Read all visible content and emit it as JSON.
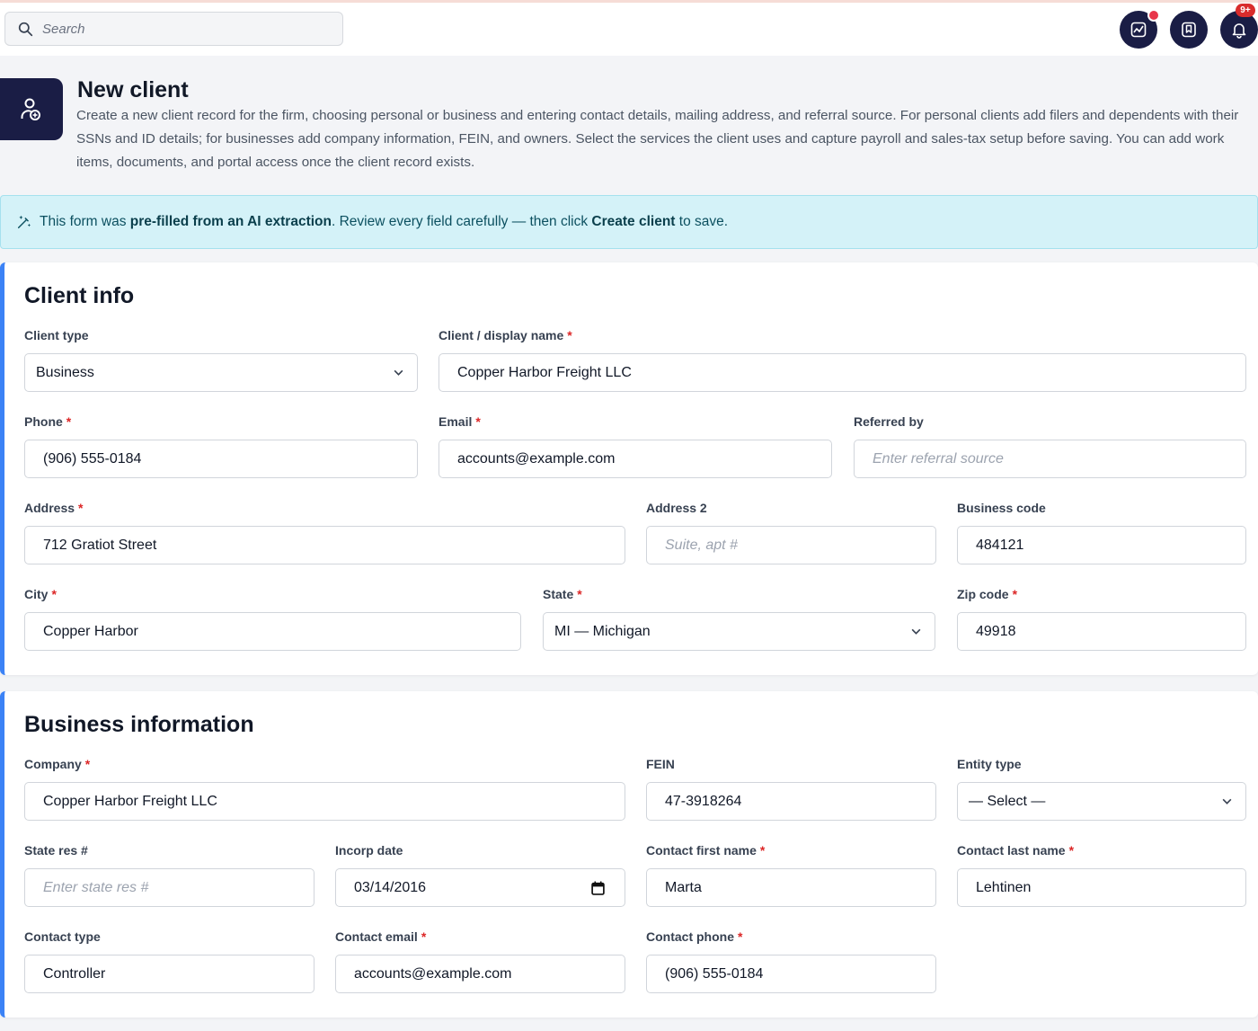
{
  "topbar": {
    "search_placeholder": "Search",
    "icons": [
      "chart-icon",
      "bookmark-icon",
      "bell-icon"
    ],
    "notification_badge": "9+"
  },
  "header": {
    "title": "New client",
    "description": "Create a new client record for the firm, choosing personal or business and entering contact details, mailing address, and referral source. For personal clients add filers and dependents with their SSNs and ID details; for businesses add company information, FEIN, and owners. Select the services the client uses and capture payroll and sales-tax setup before saving. You can add work items, documents, and portal access once the client record exists."
  },
  "banner": {
    "text1": "This form was ",
    "bold1": "pre-filled from an AI extraction",
    "text2": ". Review every field carefully — then click ",
    "bold2": "Create client",
    "text3": " to save."
  },
  "client_info": {
    "title": "Client info",
    "client_type": {
      "label": "Client type",
      "value": "Business"
    },
    "display_name": {
      "label": "Client / display name",
      "value": "Copper Harbor Freight LLC"
    },
    "phone": {
      "label": "Phone",
      "value": "(906) 555-0184"
    },
    "email": {
      "label": "Email",
      "value": "accounts@example.com"
    },
    "referred_by": {
      "label": "Referred by",
      "placeholder": "Enter referral source"
    },
    "address": {
      "label": "Address",
      "value": "712 Gratiot Street"
    },
    "address2": {
      "label": "Address 2",
      "placeholder": "Suite, apt #"
    },
    "business_code": {
      "label": "Business code",
      "value": "484121"
    },
    "city": {
      "label": "City",
      "value": "Copper Harbor"
    },
    "state": {
      "label": "State",
      "value": "MI — Michigan"
    },
    "zip": {
      "label": "Zip code",
      "value": "49918"
    }
  },
  "business_info": {
    "title": "Business information",
    "company": {
      "label": "Company",
      "value": "Copper Harbor Freight LLC"
    },
    "fein": {
      "label": "FEIN",
      "value": "47-3918264"
    },
    "entity_type": {
      "label": "Entity type",
      "value": "— Select —"
    },
    "state_res": {
      "label": "State res #",
      "placeholder": "Enter state res #"
    },
    "incorp_date": {
      "label": "Incorp date",
      "value": "03/14/2016"
    },
    "contact_first": {
      "label": "Contact first name",
      "value": "Marta"
    },
    "contact_last": {
      "label": "Contact last name",
      "value": "Lehtinen"
    },
    "contact_type": {
      "label": "Contact type",
      "value": "Controller"
    },
    "contact_email": {
      "label": "Contact email",
      "value": "accounts@example.com"
    },
    "contact_phone": {
      "label": "Contact phone",
      "value": "(906) 555-0184"
    }
  },
  "colors": {
    "navy": "#1a1d45",
    "accent": "#3b82f6",
    "banner_bg": "#d4f2f8",
    "required": "#dc2626"
  }
}
